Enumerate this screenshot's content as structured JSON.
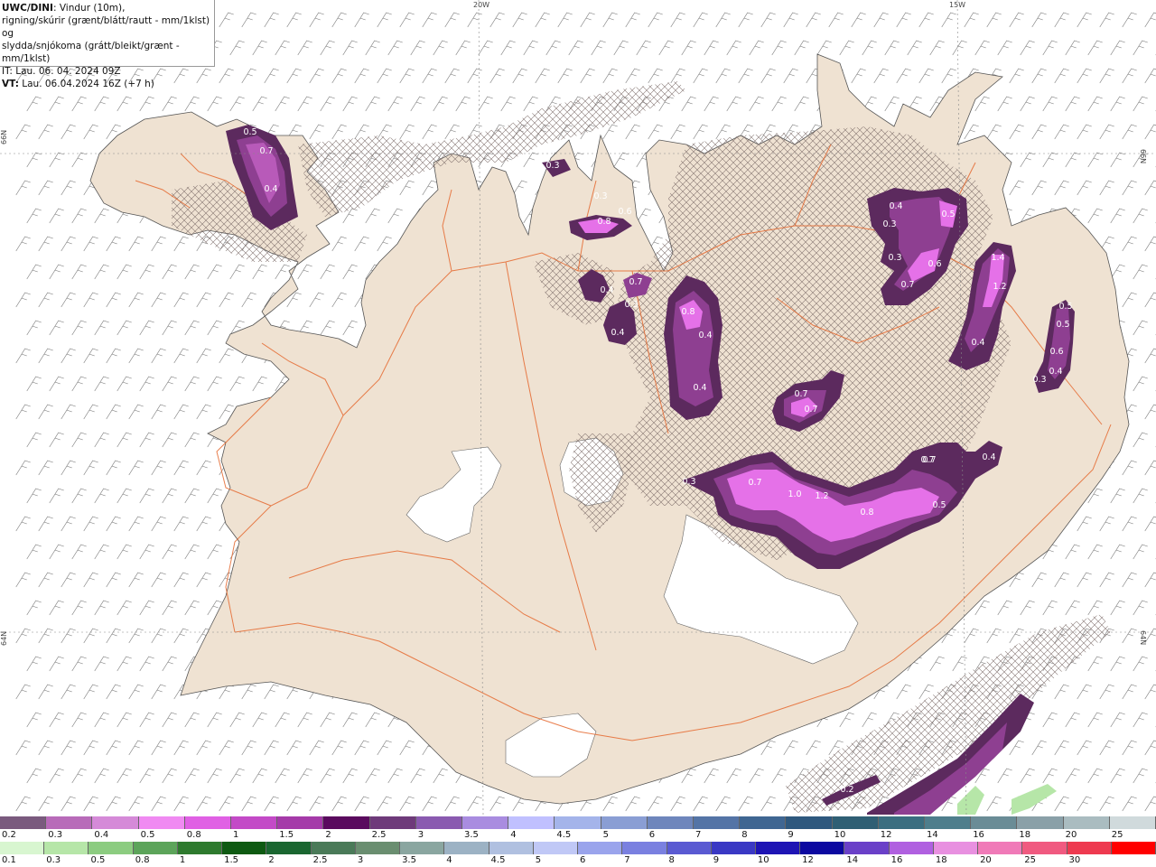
{
  "header": {
    "model": "UWC/DINI",
    "line1": ": Vindur (10m),",
    "line2": "rigning/skúrir (grænt/blátt/rautt - mm/1klst) og",
    "line3": "slydda/snjókoma (grátt/bleikt/grænt - mm/1klst)",
    "init_time": "IT: Lau. 06. 04. 2024 09Z",
    "valid_prefix": "VT:",
    "valid_time": " Lau. 06.04.2024 16Z",
    "valid_offset": " (+7 h)"
  },
  "grid_labels": {
    "lon_20w": "20W",
    "lon_15w": "15W",
    "lat_66n_left": "66N",
    "lat_66n_right": "66N",
    "lat_64n_left": "64N",
    "lat_64n_right": "64N"
  },
  "contour_labels": [
    "0.5",
    "0.7",
    "0.4",
    "0.3",
    "0.3",
    "0.8",
    "0.6",
    "0.4",
    "0.7",
    "0.3",
    "0.4",
    "0.8",
    "0.4",
    "0.4",
    "0.4",
    "0.5",
    "0.3",
    "0.6",
    "0.3",
    "0.7",
    "1.4",
    "1.2",
    "0.4",
    "0.5",
    "0.5",
    "0.6",
    "0.4",
    "0.3",
    "0.7",
    "0.7",
    "0.7",
    "0.3",
    "0.7",
    "1.0",
    "1.2",
    "0.8",
    "0.5",
    "0.7",
    "0.4",
    "0.2"
  ],
  "colors": {
    "land": "#efe2d2",
    "sea": "#ffffff",
    "roads": "#e5692f",
    "precip_dark": "#5c2a5e",
    "precip_mid": "#8e3f91",
    "precip_light": "#e571e8"
  },
  "legend_snow": {
    "labels": [
      "0.2",
      "0.3",
      "0.4",
      "0.5",
      "0.8",
      "1",
      "1.5",
      "2",
      "2.5",
      "3",
      "3.5",
      "4",
      "4.5",
      "5",
      "6",
      "7",
      "8",
      "9",
      "10",
      "12",
      "14",
      "16",
      "18",
      "20",
      "25",
      "30"
    ],
    "colors": [
      "#7a5a7e",
      "#b86bb9",
      "#d58ad8",
      "#f08af2",
      "#e060e4",
      "#c34ac7",
      "#a53aa9",
      "#5a0a5e",
      "#6e3a7a",
      "#8a5ab0",
      "#a98ce0",
      "#c0c0ff",
      "#a4b4ea",
      "#8a9ed4",
      "#6e86bc",
      "#5474a6",
      "#3f6692",
      "#2e587e",
      "#2f5f74",
      "#3a6e80",
      "#4e7e8c",
      "#6a8c96",
      "#8aa0a8",
      "#aabcc0",
      "#d0dadc"
    ]
  },
  "legend_rain": {
    "labels": [
      "0.1",
      "0.3",
      "0.5",
      "0.8",
      "1",
      "1.5",
      "2",
      "2.5",
      "3",
      "3.5",
      "4",
      "4.5",
      "5",
      "6",
      "7",
      "8",
      "9",
      "10",
      "12",
      "14",
      "16",
      "18",
      "20",
      "25",
      "30"
    ],
    "colors": [
      "#d8f6d0",
      "#b6e6a8",
      "#8ccc80",
      "#5ca45a",
      "#2e7a2e",
      "#0e5a12",
      "#1a6630",
      "#4a7a58",
      "#6a8e70",
      "#8aa6a0",
      "#9cb2c4",
      "#b0c0e0",
      "#c0c8f6",
      "#9aa4ec",
      "#7a80e0",
      "#5a5ad2",
      "#3a38c4",
      "#1e14b4",
      "#0c08a0",
      "#6a40c8",
      "#b060e0",
      "#e890e0",
      "#f07ab8",
      "#f05a80",
      "#ee3a50",
      "#ff0000"
    ]
  }
}
